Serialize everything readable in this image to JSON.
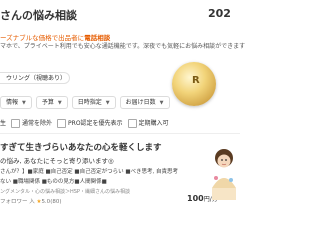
{
  "header": {
    "title": "さんの悩み相談",
    "year": "202"
  },
  "intro": {
    "headline_pre": "ーズナブルな価格で出品者に",
    "headline_bold": "電話相談",
    "description": "マホで、プライベート利用でも安心な通話機能です。深夜でも気軽にお悩み相談ができます"
  },
  "tag": {
    "label": "ウリング（視聴あり）"
  },
  "filters": [
    {
      "label": "情報"
    },
    {
      "label": "予算"
    },
    {
      "label": "日時指定"
    },
    {
      "label": "お届け日数"
    }
  ],
  "checkboxes": [
    {
      "label": "生"
    },
    {
      "label": "通常を除外"
    },
    {
      "label": "PRO認定を優先表示"
    },
    {
      "label": "定期購入可"
    }
  ],
  "card": {
    "title": "すぎて生きづらいあなたの心を軽くします",
    "subtitle": "の悩み, あなたにそっと寄り添います◎",
    "tags_line1": "さんが？】■家庭 ■自己否定 ■自己否定がつらい ■べき思考, 自責思考",
    "tags_line2": "ない ■職場関係 ■ものの見方■人間関係■",
    "path": "ングメンタル・心の悩み相談＞HSP・繊細さんの悩み相談",
    "rating_text": "フォロワー 入 ",
    "rating_star": "★",
    "rating": "5.0",
    "reviews": "(80)",
    "price_value": "100",
    "price_unit": "円/分"
  },
  "colors": {
    "accent": "#e65c00",
    "star": "#f5a623",
    "medal": "#d4a84a"
  }
}
